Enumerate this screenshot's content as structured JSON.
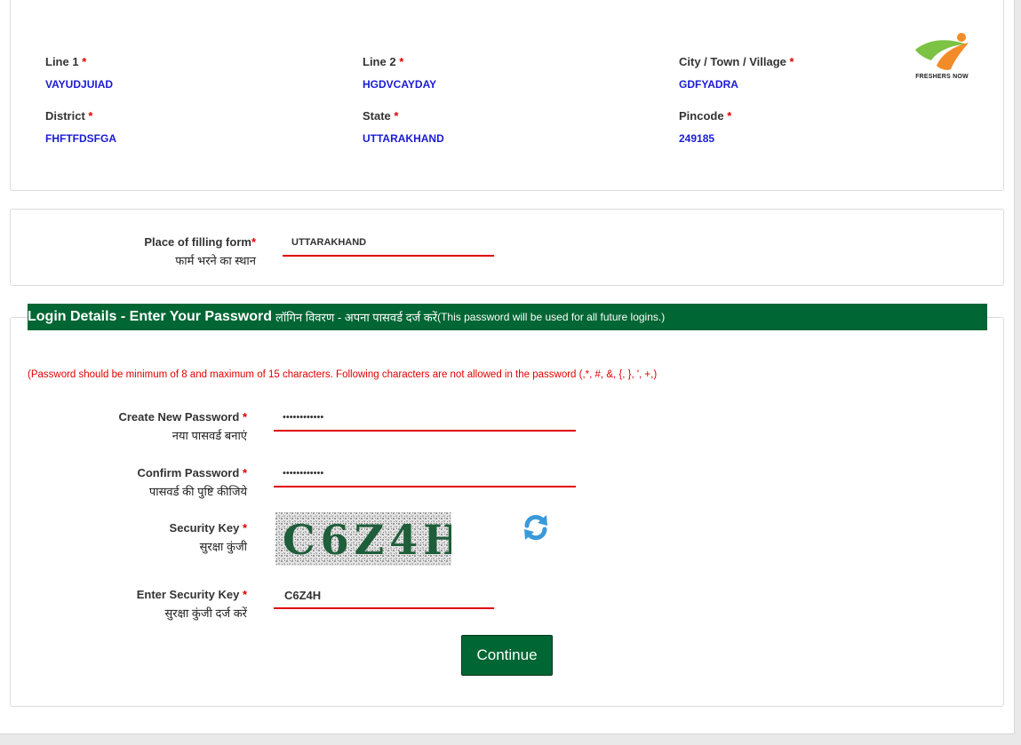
{
  "address": {
    "fields": [
      {
        "label": "Line 1",
        "value": "VAYUDJUIAD"
      },
      {
        "label": "Line 2",
        "value": "HGDVCAYDAY"
      },
      {
        "label": "City / Town / Village",
        "value": "GDFYADRA"
      },
      {
        "label": "District",
        "value": "FHFTFDSFGA"
      },
      {
        "label": "State",
        "value": "UTTARAKHAND"
      },
      {
        "label": "Pincode",
        "value": "249185"
      }
    ],
    "required_mark": "*"
  },
  "logo": {
    "text": "FRESHERS NOW",
    "icon": "freshers-now-logo"
  },
  "place": {
    "label": "Place of filling form",
    "label_hindi": "फार्म भरने का स्थान",
    "value": "UTTARAKHAND"
  },
  "login": {
    "header_main": "Login Details - Enter Your Password",
    "header_hindi": "लॉगिन विवरण - अपना पासवर्ड दर्ज करें",
    "header_note": "(This password will be used for all future logins.)",
    "password_rule": "(Password should be minimum of 8 and maximum of 15 characters. Following characters are not allowed in the password (,*, #, &, {, }, ', +,)",
    "new_password_label": "Create New Password",
    "new_password_hindi": "नया पासवर्ड बनाएं",
    "new_password_value": "••••••••••••",
    "confirm_password_label": "Confirm Password",
    "confirm_password_hindi": "पासवर्ड की पुष्टि कीजिये",
    "confirm_password_value": "••••••••••••",
    "security_key_label": "Security Key",
    "security_key_hindi": "सुरक्षा कुंजी",
    "captcha_text": "C6Z4H",
    "enter_key_label": "Enter Security Key",
    "enter_key_hindi": "सुरक्षा कुंजी दर्ज करें",
    "enter_key_value": "C6Z4H",
    "refresh_icon": "refresh-icon",
    "continue_label": "Continue"
  },
  "colors": {
    "brand_green": "#006633",
    "required_red": "#e00000",
    "value_blue": "#1a1ad6"
  }
}
